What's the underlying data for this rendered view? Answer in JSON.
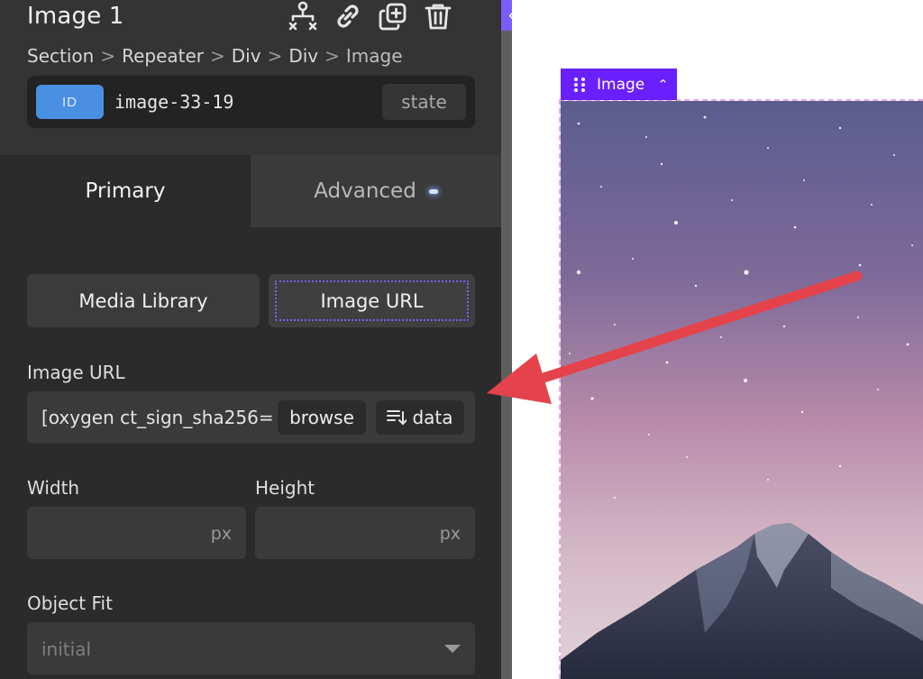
{
  "panel": {
    "title": "Image 1",
    "breadcrumb": [
      "Section",
      "Repeater",
      "Div",
      "Div",
      "Image"
    ],
    "breadcrumb_separator": ">",
    "id_badge": "ID",
    "id_value": "image-33-19",
    "state_button": "state",
    "header_icons": [
      "structure-icon",
      "link-icon",
      "duplicate-icon",
      "trash-icon"
    ]
  },
  "tabs": {
    "primary": "Primary",
    "advanced": "Advanced"
  },
  "source": {
    "media_library": "Media Library",
    "image_url": "Image URL",
    "selected": "Image URL"
  },
  "image_url": {
    "label": "Image URL",
    "value": "[oxygen ct_sign_sha256=",
    "browse": "browse",
    "data": "data"
  },
  "size": {
    "width_label": "Width",
    "height_label": "Height",
    "width_unit": "px",
    "height_unit": "px"
  },
  "object_fit": {
    "label": "Object Fit",
    "value": "initial"
  },
  "canvas": {
    "selection_label": "Image"
  },
  "colors": {
    "panel_bg": "#2b2b2b",
    "accent_purple": "#7b5cff",
    "selection_purple": "#6a1fff",
    "id_blue": "#4a90e2",
    "annotation_red": "#e4434b"
  }
}
